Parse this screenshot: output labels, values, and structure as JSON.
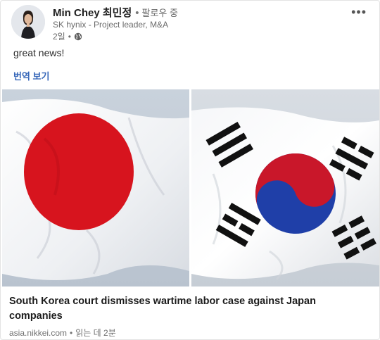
{
  "author": {
    "name": "Min Chey 최민정",
    "follow_label": "팔로우 중",
    "headline": "SK hynix - Project leader, M&A",
    "time_ago": "2일"
  },
  "header": {
    "more_label": "•••",
    "globe_icon": "globe-icon"
  },
  "post": {
    "text": "great news!",
    "translate_label": "번역 보기"
  },
  "article": {
    "title": "South Korea court dismisses wartime labor case against Japan companies",
    "source": "asia.nikkei.com",
    "read_time": "읽는 데 2분"
  },
  "colors": {
    "japan_red": "#d7141e",
    "korea_red": "#c9172a",
    "korea_blue": "#1f3fa8",
    "link_blue": "#3566b8"
  }
}
